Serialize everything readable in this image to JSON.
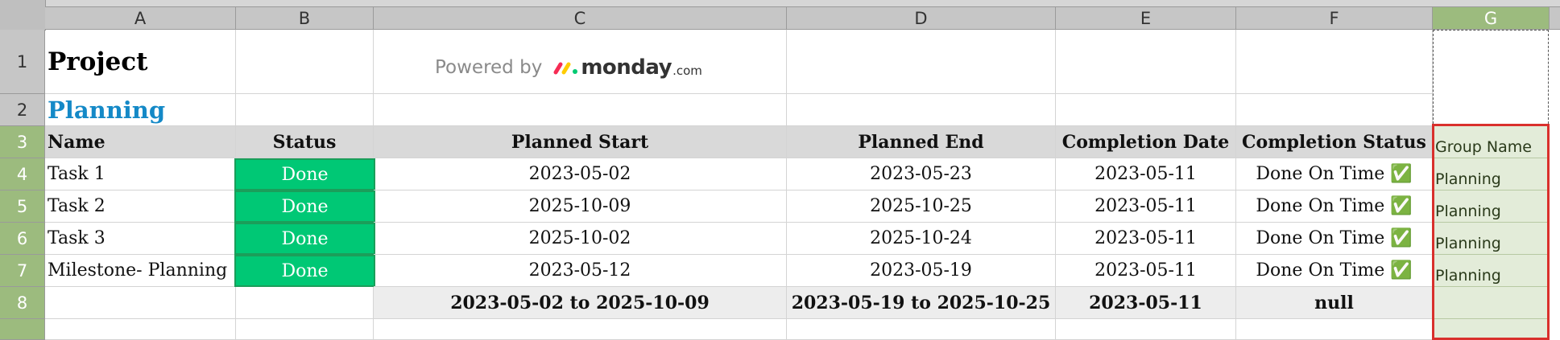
{
  "columns": [
    "A",
    "B",
    "C",
    "D",
    "E",
    "F",
    "G"
  ],
  "rows": [
    "1",
    "2",
    "3",
    "4",
    "5",
    "6",
    "7",
    "8"
  ],
  "title": "Project",
  "subtitle": "Planning",
  "logo": {
    "powered_by": "Powered by",
    "brand": "monday",
    "suffix": ".com"
  },
  "headers": {
    "name": "Name",
    "status": "Status",
    "planned_start": "Planned Start",
    "planned_end": "Planned End",
    "completion_date": "Completion Date",
    "completion_status": "Completion Status",
    "group_name": "Group Name"
  },
  "tasks": [
    {
      "name": "Task 1",
      "status": "Done",
      "planned_start": "2023-05-02",
      "planned_end": "2023-05-23",
      "completion_date": "2023-05-11",
      "completion_status": "Done On Time ✅",
      "group": "Planning"
    },
    {
      "name": "Task 2",
      "status": "Done",
      "planned_start": "2025-10-09",
      "planned_end": "2025-10-25",
      "completion_date": "2023-05-11",
      "completion_status": "Done On Time ✅",
      "group": "Planning"
    },
    {
      "name": "Task 3",
      "status": "Done",
      "planned_start": "2025-10-02",
      "planned_end": "2025-10-24",
      "completion_date": "2023-05-11",
      "completion_status": "Done On Time ✅",
      "group": "Planning"
    },
    {
      "name": "Milestone- Planning",
      "status": "Done",
      "planned_start": "2023-05-12",
      "planned_end": "2023-05-19",
      "completion_date": "2023-05-11",
      "completion_status": "Done On Time ✅",
      "group": "Planning"
    }
  ],
  "summary": {
    "planned_start": "2023-05-02 to 2025-10-09",
    "planned_end": "2023-05-19 to 2025-10-25",
    "completion_date": "2023-05-11",
    "completion_status": "null"
  },
  "colors": {
    "done": "#00c875",
    "subtitle": "#1489c7",
    "selection": "#d9302c",
    "active_header": "#9cbb7e"
  }
}
